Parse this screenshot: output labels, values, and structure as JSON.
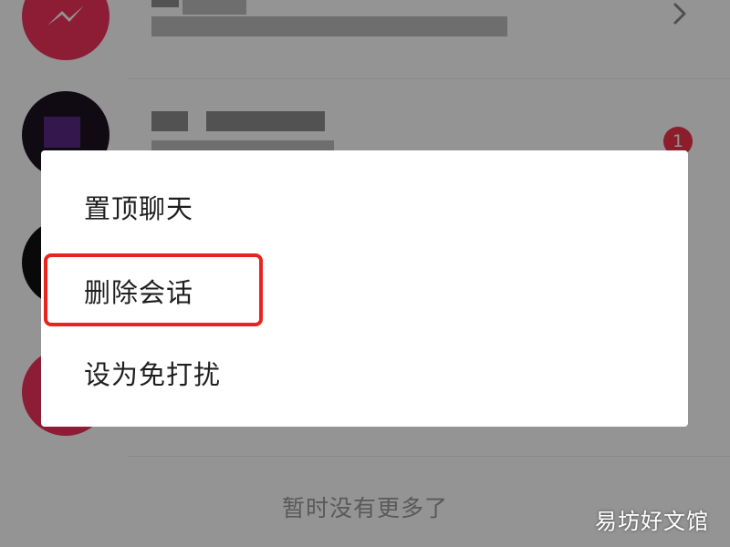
{
  "conversation_list": {
    "unread_badge": "1",
    "footer_note": "暂时没有更多了"
  },
  "context_menu": {
    "items": [
      {
        "label": "置顶聊天"
      },
      {
        "label": "删除会话"
      },
      {
        "label": "设为免打扰"
      }
    ],
    "highlighted_item": "删除会话"
  },
  "watermark": {
    "text": "易坊好文馆"
  },
  "colors": {
    "badge": "#f2324a",
    "highlight_outline": "#e8241f",
    "avatar_pink": "#f2325a"
  },
  "icons": {
    "row_arrow": "chevron-right-icon",
    "first_avatar_logo": "messenger-bolt-icon"
  }
}
